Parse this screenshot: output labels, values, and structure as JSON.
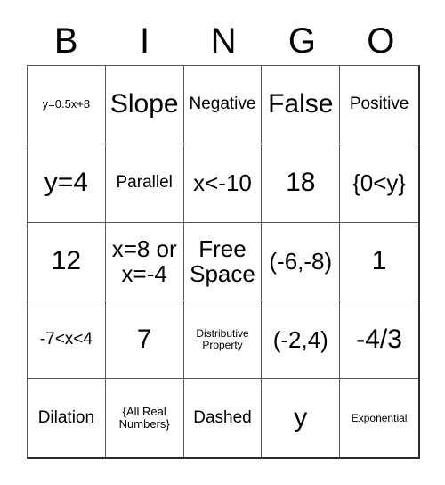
{
  "header": {
    "letters": [
      "B",
      "I",
      "N",
      "G",
      "O"
    ]
  },
  "grid": {
    "rows": [
      [
        {
          "text": "y=0.5x+8",
          "size": "sz-sm"
        },
        {
          "text": "Slope",
          "size": "sz-xl"
        },
        {
          "text": "Negative",
          "size": "sz-md"
        },
        {
          "text": "False",
          "size": "sz-xl"
        },
        {
          "text": "Positive",
          "size": "sz-md"
        }
      ],
      [
        {
          "text": "y=4",
          "size": "sz-xl"
        },
        {
          "text": "Parallel",
          "size": "sz-md"
        },
        {
          "text": "x<-10",
          "size": "sz-lg"
        },
        {
          "text": "18",
          "size": "sz-xl"
        },
        {
          "text": "{0<y}",
          "size": "sz-lg"
        }
      ],
      [
        {
          "text": "12",
          "size": "sz-xl"
        },
        {
          "text": "x=8 or\nx=-4",
          "size": "sz-lg"
        },
        {
          "text": "Free\nSpace",
          "size": "sz-lg"
        },
        {
          "text": "(-6,-8)",
          "size": "sz-lg"
        },
        {
          "text": "1",
          "size": "sz-xl"
        }
      ],
      [
        {
          "text": "-7<x<4",
          "size": "sz-md"
        },
        {
          "text": "7",
          "size": "sz-xl"
        },
        {
          "text": "Distributive\nProperty",
          "size": "sz-xs"
        },
        {
          "text": "(-2,4)",
          "size": "sz-lg"
        },
        {
          "text": "-4/3",
          "size": "sz-xl"
        }
      ],
      [
        {
          "text": "Dilation",
          "size": "sz-md"
        },
        {
          "text": "{All Real\nNumbers}",
          "size": "sz-sm"
        },
        {
          "text": "Dashed",
          "size": "sz-md"
        },
        {
          "text": "y",
          "size": "sz-xl"
        },
        {
          "text": "Exponential",
          "size": "sz-xs"
        }
      ]
    ]
  },
  "colors": {
    "grid_line": "#58585a",
    "outer_line": "#2b2b2b",
    "text": "#000000",
    "background": "#ffffff"
  }
}
